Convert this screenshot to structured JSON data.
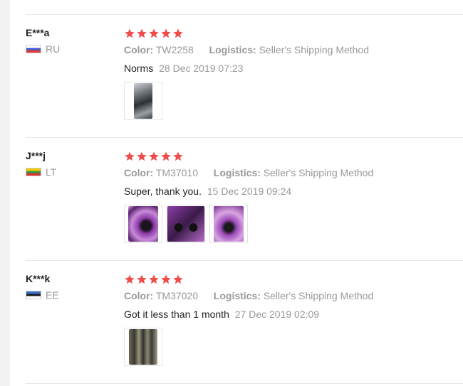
{
  "reviews": [
    {
      "user": "E***a",
      "country": "RU",
      "flag_colors": [
        "#ffffff",
        "#3b5bd8",
        "#e03a3a"
      ],
      "stars": 5,
      "color_label": "Color:",
      "color_value": "TW2258",
      "logistics_label": "Logistics:",
      "logistics_value": "Seller's Shipping Method",
      "text": "Norms",
      "date": "28 Dec 2019 07:23",
      "photos": [
        "photo-1"
      ]
    },
    {
      "user": "J***j",
      "country": "LT",
      "flag_colors": [
        "#f6c600",
        "#2e9c43",
        "#d8322f"
      ],
      "stars": 5,
      "color_label": "Color:",
      "color_value": "TM37010",
      "logistics_label": "Logistics:",
      "logistics_value": "Seller's Shipping Method",
      "text": "Super, thank you.",
      "date": "15 Dec 2019 09:24",
      "photos": [
        "photo-1",
        "photo-2",
        "photo-3"
      ]
    },
    {
      "user": "K***k",
      "country": "EE",
      "flag_colors": [
        "#3b6cc9",
        "#1a1a1a",
        "#ffffff"
      ],
      "stars": 5,
      "color_label": "Color:",
      "color_value": "TM37020",
      "logistics_label": "Logistics:",
      "logistics_value": "Seller's Shipping Method",
      "text": "Got it less than 1 month",
      "date": "27 Dec 2019 02:09",
      "photos": [
        "photo-1"
      ]
    }
  ],
  "colors": {
    "star": "#f04c4c",
    "muted_text": "#999999",
    "divider": "#e8e8e8"
  },
  "icons": {
    "star": "star-icon",
    "flag": "flag-icon"
  }
}
